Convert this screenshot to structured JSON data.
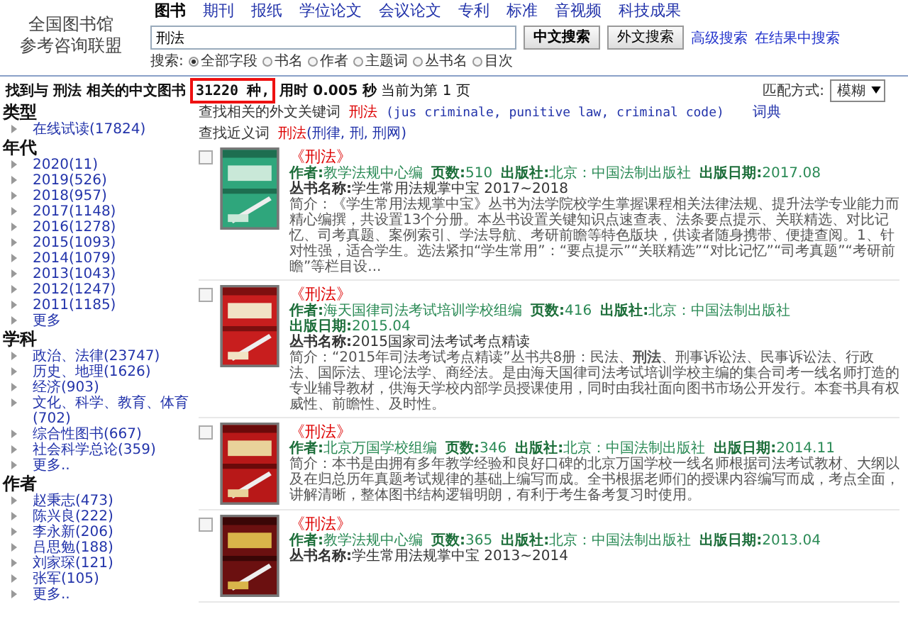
{
  "logo": {
    "lines": [
      "全国图书馆",
      "参考咨询联盟"
    ]
  },
  "tabs": [
    {
      "label": "图书",
      "selected": true
    },
    {
      "label": "期刊",
      "selected": false
    },
    {
      "label": "报纸",
      "selected": false
    },
    {
      "label": "学位论文",
      "selected": false
    },
    {
      "label": "会议论文",
      "selected": false
    },
    {
      "label": "专利",
      "selected": false
    },
    {
      "label": "标准",
      "selected": false
    },
    {
      "label": "音视频",
      "selected": false
    },
    {
      "label": "科技成果",
      "selected": false
    }
  ],
  "search": {
    "value": "刑法",
    "buttons": [
      "中文搜索",
      "外文搜索"
    ],
    "links": [
      "高级搜索",
      "在结果中搜索"
    ],
    "scope_label": "搜索:",
    "scopes": [
      {
        "label": "全部字段",
        "selected": true
      },
      {
        "label": "书名",
        "selected": false
      },
      {
        "label": "作者",
        "selected": false
      },
      {
        "label": "主题词",
        "selected": false
      },
      {
        "label": "丛书名",
        "selected": false
      },
      {
        "label": "目次",
        "selected": false
      }
    ]
  },
  "result_summary": {
    "prefix": "找到与 **刑法** 相关的**中文图书**",
    "count": "31220 种,",
    "suffix": "用时 0.005 秒",
    "page": "当前为第 1 页"
  },
  "match": {
    "label": "匹配方式:",
    "value": "模糊"
  },
  "sidebar": [
    {
      "title": "类型",
      "items": [
        "在线试读(17824)"
      ]
    },
    {
      "title": "年代",
      "items": [
        "2020(11)",
        "2019(526)",
        "2018(957)",
        "2017(1148)",
        "2016(1278)",
        "2015(1093)",
        "2014(1079)",
        "2013(1043)",
        "2012(1247)",
        "2011(1185)",
        "更多"
      ]
    },
    {
      "title": "学科",
      "items": [
        "政治、法律(23747)",
        "历史、地理(1626)",
        "经济(903)",
        "文化、科学、教育、体育(702)",
        "综合性图书(667)",
        "社会科学总论(359)",
        "更多.."
      ]
    },
    {
      "title": "作者",
      "items": [
        "赵秉志(473)",
        "陈兴良(222)",
        "李永新(206)",
        "吕思勉(188)",
        "刘家琛(121)",
        "张军(105)",
        "更多.."
      ]
    }
  ],
  "foreign_keywords": {
    "label": "查找相关的外文关键词",
    "term": "刑法",
    "translations": "(jus criminale, punitive law, criminal code)",
    "link": "词典"
  },
  "synonyms": {
    "label": "查找近义词",
    "term": "刑法",
    "words": "(刑律, 刑, 刑网)"
  },
  "books": [
    {
      "checked": false,
      "title": "《刑法》",
      "fields": [
        {
          "label": "作者:",
          "value": "教学法规中心编"
        },
        {
          "label": "页数:",
          "value": "510"
        },
        {
          "label": "出版社:",
          "value": "北京：中国法制出版社"
        },
        {
          "label": "出版日期:",
          "value": "2017.08"
        }
      ],
      "series_label": "丛书名称:",
      "series": "学生常用法规掌中宝 2017~2018",
      "summary": "简介：《学生常用法规掌中宝》丛书为法学院校学生掌握课程相关法律法规、提升法学专业能力而精心编撰，共设置13个分册。本丛书设置关键知识点速查表、法条要点提示、关联精选、对比记忆、司考真题、案例索引、学法导航、考研前瞻等特色版块，供读者随身携带、便捷查阅。1、针对性强，适合学生。选法紧扣“学生常用”：“要点提示”“关联精选”“对比记忆”“司考真题”“考研前瞻”等栏目设..."
    },
    {
      "checked": false,
      "title": "《刑法》",
      "fields": [
        {
          "label": "作者:",
          "value": "海天国律司法考试培训学校组编"
        },
        {
          "label": "页数:",
          "value": "416"
        },
        {
          "label": "出版社:",
          "value": "北京：中国法制出版社"
        },
        {
          "label": "出版日期:",
          "value": "2015.04"
        }
      ],
      "series_label": "丛书名称:",
      "series": "2015国家司法考试考点精读",
      "summary": "简介：“2015年司法考试考点精读”丛书共8册：民法、**刑法**、刑事诉讼法、民事诉讼法、行政法、国际法、理论法学、商经法。是由海天国律司法考试培训学校主编的集合司考一线名师打造的专业辅导教材，供海天学校内部学员授课使用，同时由我社面向图书市场公开发行。本套书具有权威性、前瞻性、及时性。"
    },
    {
      "checked": false,
      "title": "《刑法》",
      "fields": [
        {
          "label": "作者:",
          "value": "北京万国学校组编"
        },
        {
          "label": "页数:",
          "value": "346"
        },
        {
          "label": "出版社:",
          "value": "北京：中国法制出版社"
        },
        {
          "label": "出版日期:",
          "value": "2014.11"
        }
      ],
      "summary": "简介：本书是由拥有多年教学经验和良好口碑的北京万国学校一线名师根据司法考试教材、大纲以及在归总历年真题考试规律的基础上编写而成。全书根据老师们的授课内容编写而成，考点全面，讲解清晰，整体图书结构逻辑明朗，有利于考生备考复习时使用。"
    },
    {
      "checked": false,
      "title": "《刑法》",
      "fields": [
        {
          "label": "作者:",
          "value": "教学法规中心编"
        },
        {
          "label": "页数:",
          "value": "365"
        },
        {
          "label": "出版社:",
          "value": "北京：中国法制出版社"
        },
        {
          "label": "出版日期:",
          "value": "2013.04"
        }
      ],
      "series_label": "丛书名称:",
      "series": "学生常用法规掌中宝 2013~2014"
    }
  ]
}
